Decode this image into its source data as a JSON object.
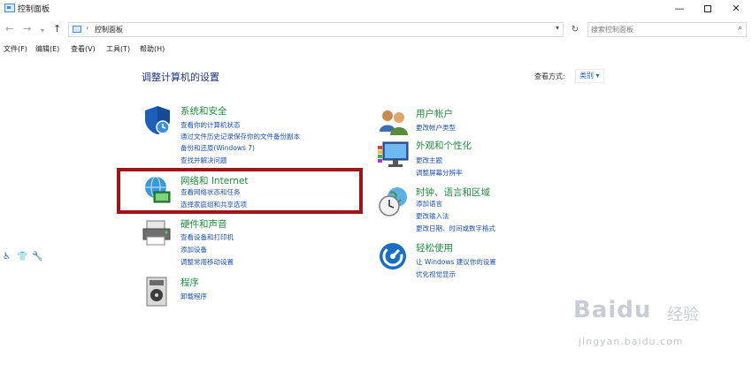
{
  "window": {
    "title": "控制面板"
  },
  "address": {
    "breadcrumb": "控制面板",
    "search_placeholder": "搜索控制面板"
  },
  "menu": [
    "文件(F)",
    "编辑(E)",
    "查看(V)",
    "工具(T)",
    "帮助(H)"
  ],
  "main": {
    "heading": "调整计算机的设置",
    "view_by_label": "查看方式:",
    "view_mode": "类别 ▾"
  },
  "categories": [
    {
      "title": "系统和安全",
      "links": [
        "查看你的计算机状态",
        "通过文件历史记录保存你的文件备份副本",
        "备份和还原(Windows 7)",
        "查找并解决问题"
      ]
    },
    {
      "title": "网络和 Internet",
      "links": [
        "查看网络状态和任务",
        "选择家庭组和共享选项"
      ]
    },
    {
      "title": "硬件和声音",
      "links": [
        "查看设备和打印机",
        "添加设备",
        "调整常用移动设置"
      ]
    },
    {
      "title": "程序",
      "links": [
        "卸载程序"
      ]
    },
    {
      "title": "用户帐户",
      "links": [
        "更改帐户类型"
      ]
    },
    {
      "title": "外观和个性化",
      "links": [
        "更改主题",
        "调整屏幕分辨率"
      ]
    },
    {
      "title": "时钟、语言和区域",
      "links": [
        "添加语言",
        "更改输入法",
        "更改日期、时间或数字格式"
      ]
    },
    {
      "title": "轻松使用",
      "links": [
        "让 Windows 建议你的设置",
        "优化视觉显示"
      ]
    }
  ],
  "watermark": {
    "brand": "Baidu",
    "brand_cn": "经验",
    "url": "jingyan.baidu.com"
  },
  "colors": {
    "category_title": "#1e8c3c",
    "link": "#1a4fb8",
    "highlight_box": "#a01418",
    "heading": "#1e3287"
  }
}
